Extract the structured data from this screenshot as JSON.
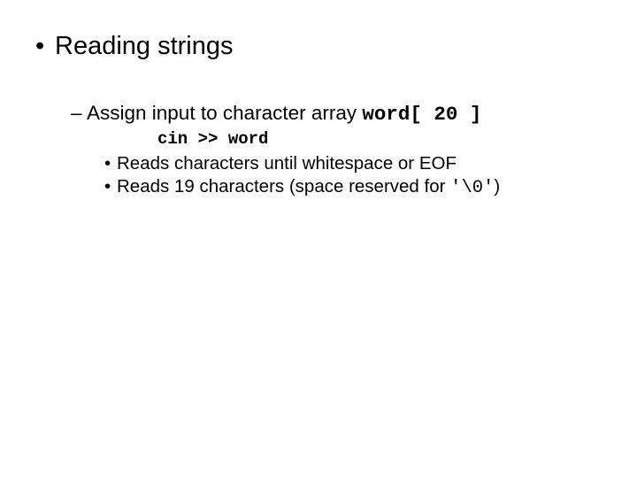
{
  "l1": {
    "title": "Reading strings"
  },
  "l2": {
    "line1_prefix": "Assign input to character array ",
    "line1_code": "word[ 20 ]"
  },
  "code": {
    "snippet": "cin >> word"
  },
  "l3": {
    "item1": "Reads characters until whitespace or EOF",
    "item2_prefix": "Reads 19 characters (space reserved for ",
    "item2_code": "'\\0'",
    "item2_suffix": ")"
  }
}
